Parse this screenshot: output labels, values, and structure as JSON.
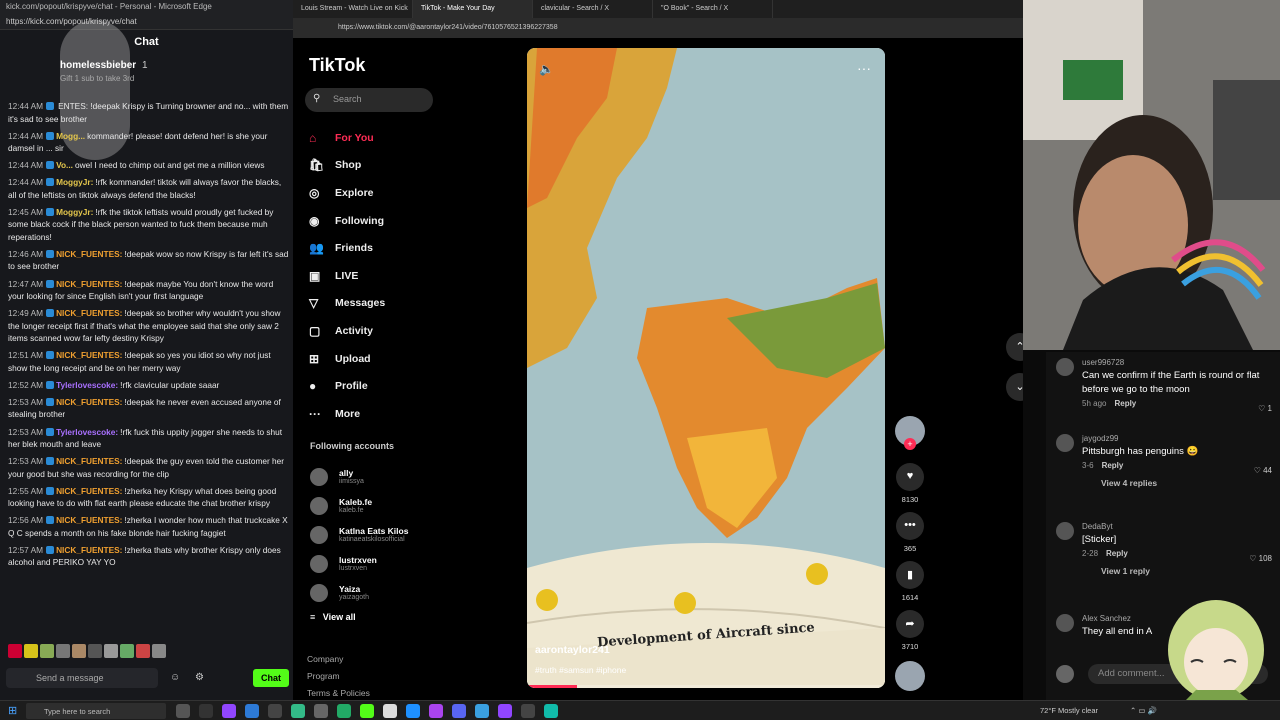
{
  "kick": {
    "window_title": "kick.com/popout/krispyve/chat - Personal - Microsoft Edge",
    "url": "https://kick.com/popout/krispyve/chat",
    "header": "Chat",
    "pinned_user": "homelessbieber",
    "pinned_count": "1",
    "pinned_text": "Gift 1 sub to take 3rd",
    "messages": [
      {
        "time": "12:44 AM",
        "user": "",
        "color": "#e8e8e8",
        "text": "ENTES: !deepak Krispy is Turning browner and no... with them it's sad to see brother"
      },
      {
        "time": "12:44 AM",
        "user": "Mogg...",
        "color": "#e6c84c",
        "text": "kommander! please! dont defend her! is she your damsel in ... sir"
      },
      {
        "time": "12:44 AM",
        "user": "Vo...",
        "color": "#e6c84c",
        "text": "owel I need to chimp out and get me a million views"
      },
      {
        "time": "12:44 AM",
        "user": "MoggyJr:",
        "color": "#e6c84c",
        "text": "!rfk kommander! tiktok will always favor the blacks, all of the leftists on tiktok always defend the blacks!"
      },
      {
        "time": "12:45 AM",
        "user": "MoggyJr:",
        "color": "#e6c84c",
        "text": "!rfk the tiktok leftists would proudly get fucked by some black cock if the black person wanted to fuck them because muh reperations!"
      },
      {
        "time": "12:46 AM",
        "user": "NICK_FUENTES:",
        "color": "#f0a030",
        "text": "!deepak wow so now Krispy is far left it's sad to see brother"
      },
      {
        "time": "12:47 AM",
        "user": "NICK_FUENTES:",
        "color": "#f0a030",
        "text": "!deepak maybe You don't know the word your looking for since English isn't your first language"
      },
      {
        "time": "12:49 AM",
        "user": "NICK_FUENTES:",
        "color": "#f0a030",
        "text": "!deepak so brother why wouldn't you show the longer receipt first if that's what the employee said that she only saw 2 items scanned wow far lefty destiny Krispy"
      },
      {
        "time": "12:51 AM",
        "user": "NICK_FUENTES:",
        "color": "#f0a030",
        "text": "!deepak so yes you idiot so why not just show the long receipt and be on her merry way"
      },
      {
        "time": "12:52 AM",
        "user": "Tylerlovescoke:",
        "color": "#a970ff",
        "text": "!rfk clavicular update saaar"
      },
      {
        "time": "12:53 AM",
        "user": "NICK_FUENTES:",
        "color": "#f0a030",
        "text": "!deepak he never even accused anyone of stealing brother"
      },
      {
        "time": "12:53 AM",
        "user": "Tylerlovescoke:",
        "color": "#a970ff",
        "text": "!rfk fuck this uppity jogger she needs to shut her blek mouth and leave"
      },
      {
        "time": "12:53 AM",
        "user": "NICK_FUENTES:",
        "color": "#f0a030",
        "text": "!deepak the guy even told the customer her your good but she was recording for the clip"
      },
      {
        "time": "12:55 AM",
        "user": "NICK_FUENTES:",
        "color": "#f0a030",
        "text": "!zherka hey Krispy what does being good looking have to do with flat earth please educate the chat brother krispy"
      },
      {
        "time": "12:56 AM",
        "user": "NICK_FUENTES:",
        "color": "#f0a030",
        "text": "!zherka I wonder how much that truckcake X Q C spends a month on his fake blonde hair fucking faggiet"
      },
      {
        "time": "12:57 AM",
        "user": "NICK_FUENTES:",
        "color": "#f0a030",
        "text": "!zherka thats why brother Krispy only does alcohol and PERIKO YAY YO"
      }
    ],
    "send_placeholder": "Send a message",
    "chat_button": "Chat"
  },
  "edge": {
    "tabs": [
      {
        "label": "Louis Stream - Watch Live on Kick",
        "active": false
      },
      {
        "label": "TikTok - Make Your Day",
        "active": true
      },
      {
        "label": "clavicular - Search / X",
        "active": false
      },
      {
        "label": "\"O Book\" - Search / X",
        "active": false
      }
    ],
    "url": "https://www.tiktok.com/@aarontaylor241/video/7610576521396227358"
  },
  "tiktok": {
    "logo": "TikTok",
    "search_placeholder": "Search",
    "nav": [
      {
        "label": "For You",
        "icon": "home-icon",
        "glyph": "⌂",
        "active": true
      },
      {
        "label": "Shop",
        "icon": "shop-icon",
        "glyph": "🛍",
        "active": false
      },
      {
        "label": "Explore",
        "icon": "compass-icon",
        "glyph": "◎",
        "active": false
      },
      {
        "label": "Following",
        "icon": "following-avatar-icon",
        "glyph": "◉",
        "active": false
      },
      {
        "label": "Friends",
        "icon": "friends-icon",
        "glyph": "👥",
        "active": false
      },
      {
        "label": "LIVE",
        "icon": "live-icon",
        "glyph": "▣",
        "active": false
      },
      {
        "label": "Messages",
        "icon": "messages-icon",
        "glyph": "▽",
        "active": false
      },
      {
        "label": "Activity",
        "icon": "activity-icon",
        "glyph": "▢",
        "active": false
      },
      {
        "label": "Upload",
        "icon": "upload-icon",
        "glyph": "⊞",
        "active": false
      },
      {
        "label": "Profile",
        "icon": "profile-icon",
        "glyph": "●",
        "active": false
      },
      {
        "label": "More",
        "icon": "more-icon",
        "glyph": "···",
        "active": false
      }
    ],
    "following_header": "Following accounts",
    "following": [
      {
        "name": "ally",
        "handle": "iimissya"
      },
      {
        "name": "Kaleb.fe",
        "handle": "kaleb.fe"
      },
      {
        "name": "Katlna Eats Kilos",
        "handle": "katinaeatskilosofficial"
      },
      {
        "name": "lustrxven",
        "handle": "lustrxven"
      },
      {
        "name": "Yaiza",
        "handle": "yaizagoth"
      }
    ],
    "view_all": "View all",
    "footer": [
      "Company",
      "Program",
      "Terms & Policies"
    ],
    "video": {
      "author": "aarontaylor241",
      "tags": "#truth #samsun #iphone",
      "caption_overlay": "Development of Aircraft since",
      "progress": 0.14
    },
    "actions": {
      "likes": "8130",
      "comments": "365",
      "saves": "1614",
      "shares": "3710"
    },
    "comments": [
      {
        "user": "user996728",
        "text": "Can we confirm if the Earth is round or flat before we go to the moon",
        "age": "5h ago",
        "reply": "Reply",
        "likes": "1",
        "replies": ""
      },
      {
        "user": "jaygodz99",
        "text": "Pittsburgh has penguins 😀",
        "age": "3-6",
        "reply": "Reply",
        "likes": "44",
        "replies": "View 4 replies"
      },
      {
        "user": "DedaByt",
        "text": "[Sticker]",
        "age": "2-28",
        "reply": "Reply",
        "likes": "108",
        "replies": "View 1 reply"
      },
      {
        "user": "Alex Sanchez",
        "text": "They all end in A",
        "age": "",
        "reply": "",
        "likes": "",
        "replies": ""
      }
    ],
    "add_comment_placeholder": "Add comment..."
  },
  "taskbar": {
    "search_placeholder": "Type here to search",
    "weather": "72°F  Mostly clear"
  }
}
